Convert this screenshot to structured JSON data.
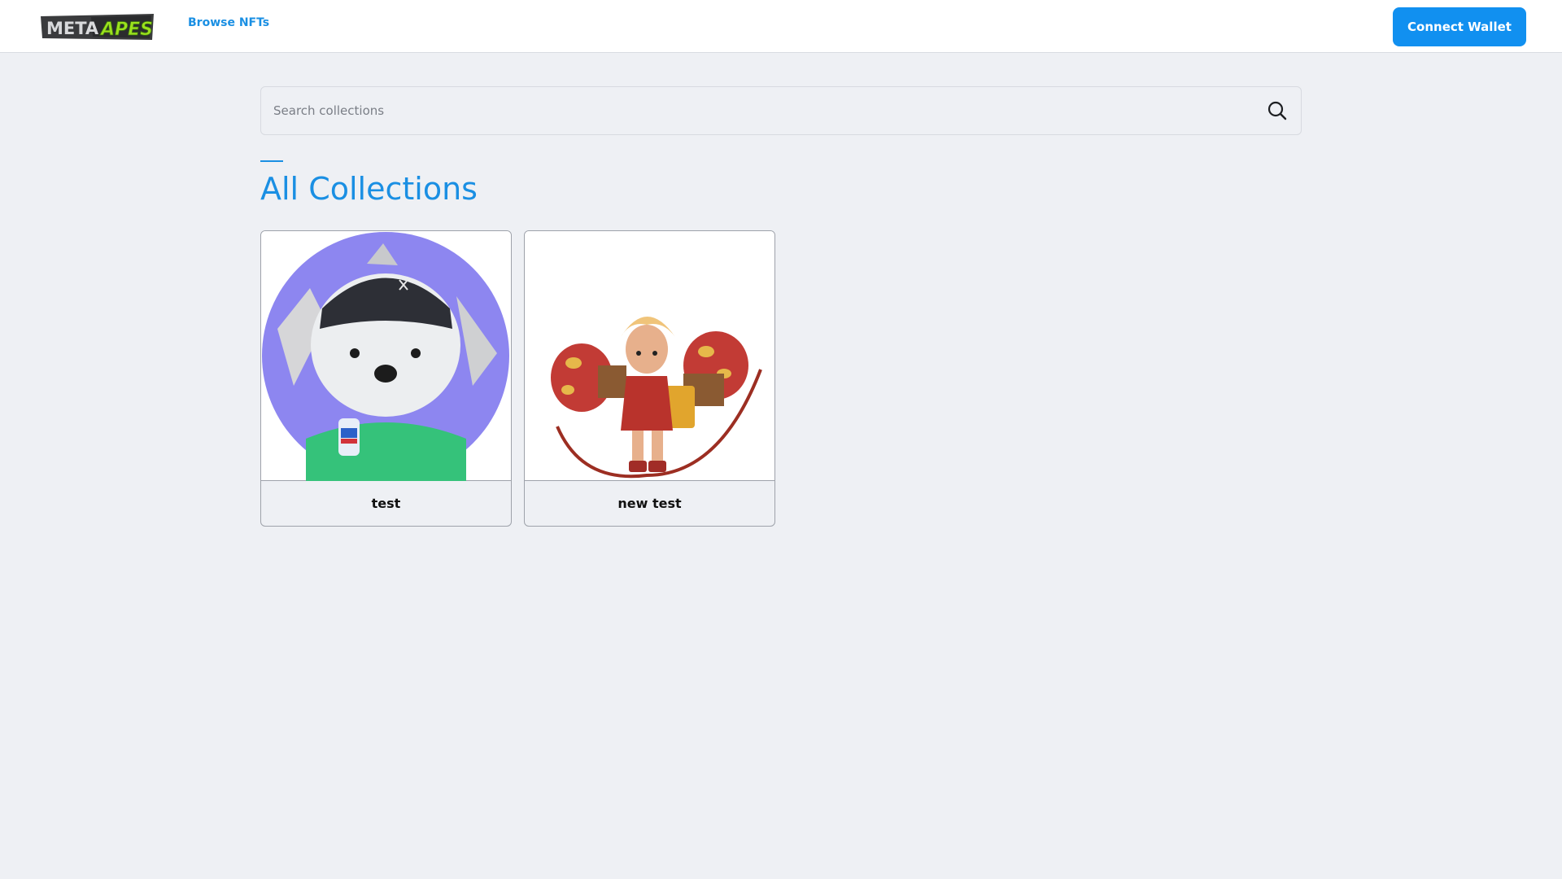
{
  "header": {
    "logo": {
      "text_left": "META",
      "text_right": "APES",
      "icon": "meta-apes-logo"
    },
    "nav_link": "Browse NFTs",
    "connect_button": "Connect Wallet"
  },
  "search": {
    "placeholder": "Search collections",
    "value": "",
    "icon": "search-icon"
  },
  "main": {
    "title": "All Collections",
    "collections": [
      {
        "label": "test",
        "image": "polar-bear-ape-avatar"
      },
      {
        "label": "new test",
        "image": "warrior-girl-with-gauntlets"
      }
    ]
  },
  "colors": {
    "accent": "#1a8fe3",
    "button": "#1190f0",
    "background": "#eef0f4",
    "logo_green": "#9be11d"
  }
}
